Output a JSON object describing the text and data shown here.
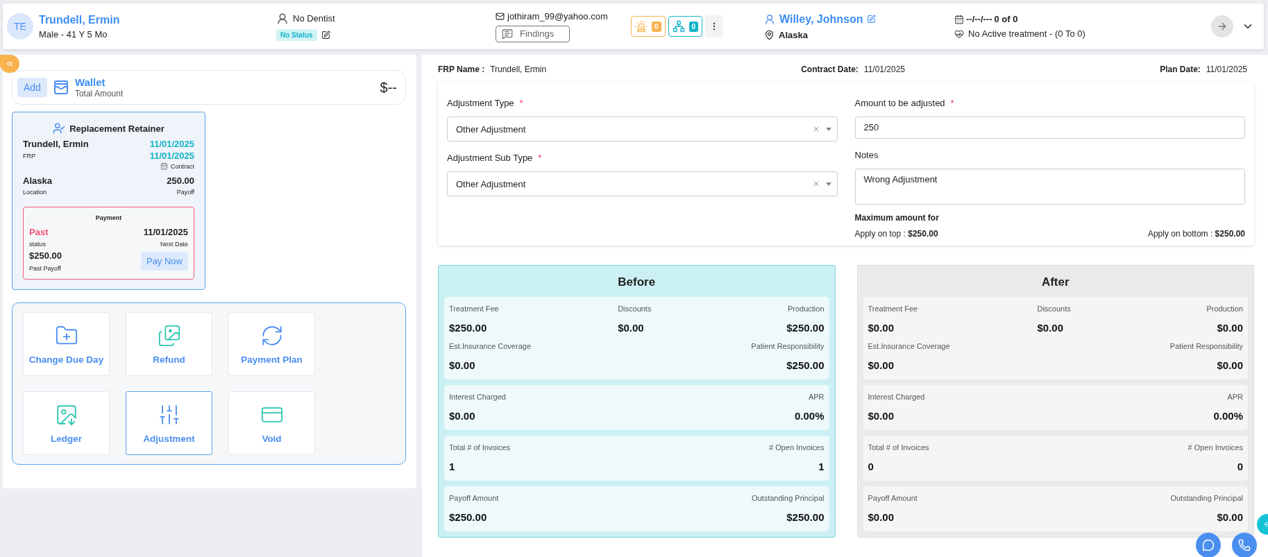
{
  "header": {
    "patient": {
      "initials": "TE",
      "name": "Trundell, Ermin",
      "details": "Male - 41 Y 5 Mo"
    },
    "dentist": "No Dentist",
    "status_badge": "No Status",
    "email": "jothiram_99@yahoo.com",
    "findings_button": "Findings",
    "alert_count": "0",
    "tree_count": "0",
    "provider": "Willey, Johnson",
    "location": "Alaska",
    "schedule": {
      "date": "--/--/---",
      "count": "0 of 0"
    },
    "treatment": "No Active treatment - (0 To 0)"
  },
  "wallet": {
    "add_button": "Add",
    "title": "Wallet",
    "subtitle": "Total Amount",
    "amount": "$--"
  },
  "plan_card": {
    "title": "Replacement Retainer",
    "name": "Trundell, Ermin",
    "name_label": "FRP",
    "date_1": "11/01/2025",
    "date_2": "11/01/2025",
    "date_label": "Contract",
    "location": "Alaska",
    "location_label": "Location",
    "payoff": "250.00",
    "payoff_label": "Payoff",
    "payment": {
      "title": "Payment",
      "status": "Past",
      "status_label": "status",
      "next_date": "11/01/2025",
      "next_label": "Next Date",
      "amount": "$250.00",
      "amount_label": "Past Payoff",
      "button": "Pay Now"
    }
  },
  "actions": [
    {
      "label": "Change Due Day",
      "selected": false
    },
    {
      "label": "Refund",
      "selected": false
    },
    {
      "label": "Payment Plan",
      "selected": false
    },
    {
      "label": "Ledger",
      "selected": false
    },
    {
      "label": "Adjustment",
      "selected": true
    },
    {
      "label": "Void",
      "selected": false
    }
  ],
  "summary": [
    {
      "label": "FRP Name :",
      "value": "Trundell, Ermin"
    },
    {
      "label": "Contract Date:",
      "value": "11/01/2025"
    },
    {
      "label": "Plan Date:",
      "value": "11/01/2025"
    }
  ],
  "form": {
    "adjustment_type": {
      "label": "Adjustment Type",
      "mark": "*",
      "value": "Other Adjustment"
    },
    "sub_type": {
      "label": "Adjustment Sub Type",
      "mark": "*",
      "value": "Other Adjustment"
    },
    "amount": {
      "label": "Amount to be adjusted",
      "mark": "*",
      "value": "250"
    },
    "notes": {
      "label": "Notes",
      "value": "Wrong Adjustment"
    },
    "maximum_title": "Maximum amount for",
    "apply_top": {
      "label": "Apply on top :",
      "value": "$250.00"
    },
    "apply_bottom": {
      "label": "Apply on bottom :",
      "value": "$250.00"
    }
  },
  "comparison": [
    {
      "kind": "before",
      "title": "Before",
      "sections": [
        [
          [
            {
              "label": "Treatment Fee",
              "value": "$250.00"
            },
            {
              "label": "Discounts",
              "value": "$0.00"
            },
            {
              "label": "Production",
              "value": "$250.00"
            }
          ],
          [
            {
              "label": "Est.Insurance Coverage",
              "value": "$0.00"
            },
            {
              "label": "Patient Responsibility",
              "value": "$250.00"
            }
          ]
        ],
        [
          [
            {
              "label": "Interest Charged",
              "value": "$0.00"
            },
            {
              "label": "APR",
              "value": "0.00%"
            }
          ]
        ],
        [
          [
            {
              "label": "Total # of Invoices",
              "value": "1"
            },
            {
              "label": "# Open Invoices",
              "value": "1"
            }
          ]
        ],
        [
          [
            {
              "label": "Payoff Amount",
              "value": "$250.00"
            },
            {
              "label": "Outstanding Principal",
              "value": "$250.00"
            }
          ]
        ]
      ]
    },
    {
      "kind": "after",
      "title": "After",
      "sections": [
        [
          [
            {
              "label": "Treatment Fee",
              "value": "$0.00"
            },
            {
              "label": "Discounts",
              "value": "$0.00"
            },
            {
              "label": "Production",
              "value": "$0.00"
            }
          ],
          [
            {
              "label": "Est.Insurance Coverage",
              "value": "$0.00"
            },
            {
              "label": "Patient Responsibility",
              "value": "$0.00"
            }
          ]
        ],
        [
          [
            {
              "label": "Interest Charged",
              "value": "$0.00"
            },
            {
              "label": "APR",
              "value": "0.00%"
            }
          ]
        ],
        [
          [
            {
              "label": "Total # of Invoices",
              "value": "0"
            },
            {
              "label": "# Open Invoices",
              "value": "0"
            }
          ]
        ],
        [
          [
            {
              "label": "Payoff Amount",
              "value": "$0.00"
            },
            {
              "label": "Outstanding Principal",
              "value": "$0.00"
            }
          ]
        ]
      ]
    }
  ]
}
